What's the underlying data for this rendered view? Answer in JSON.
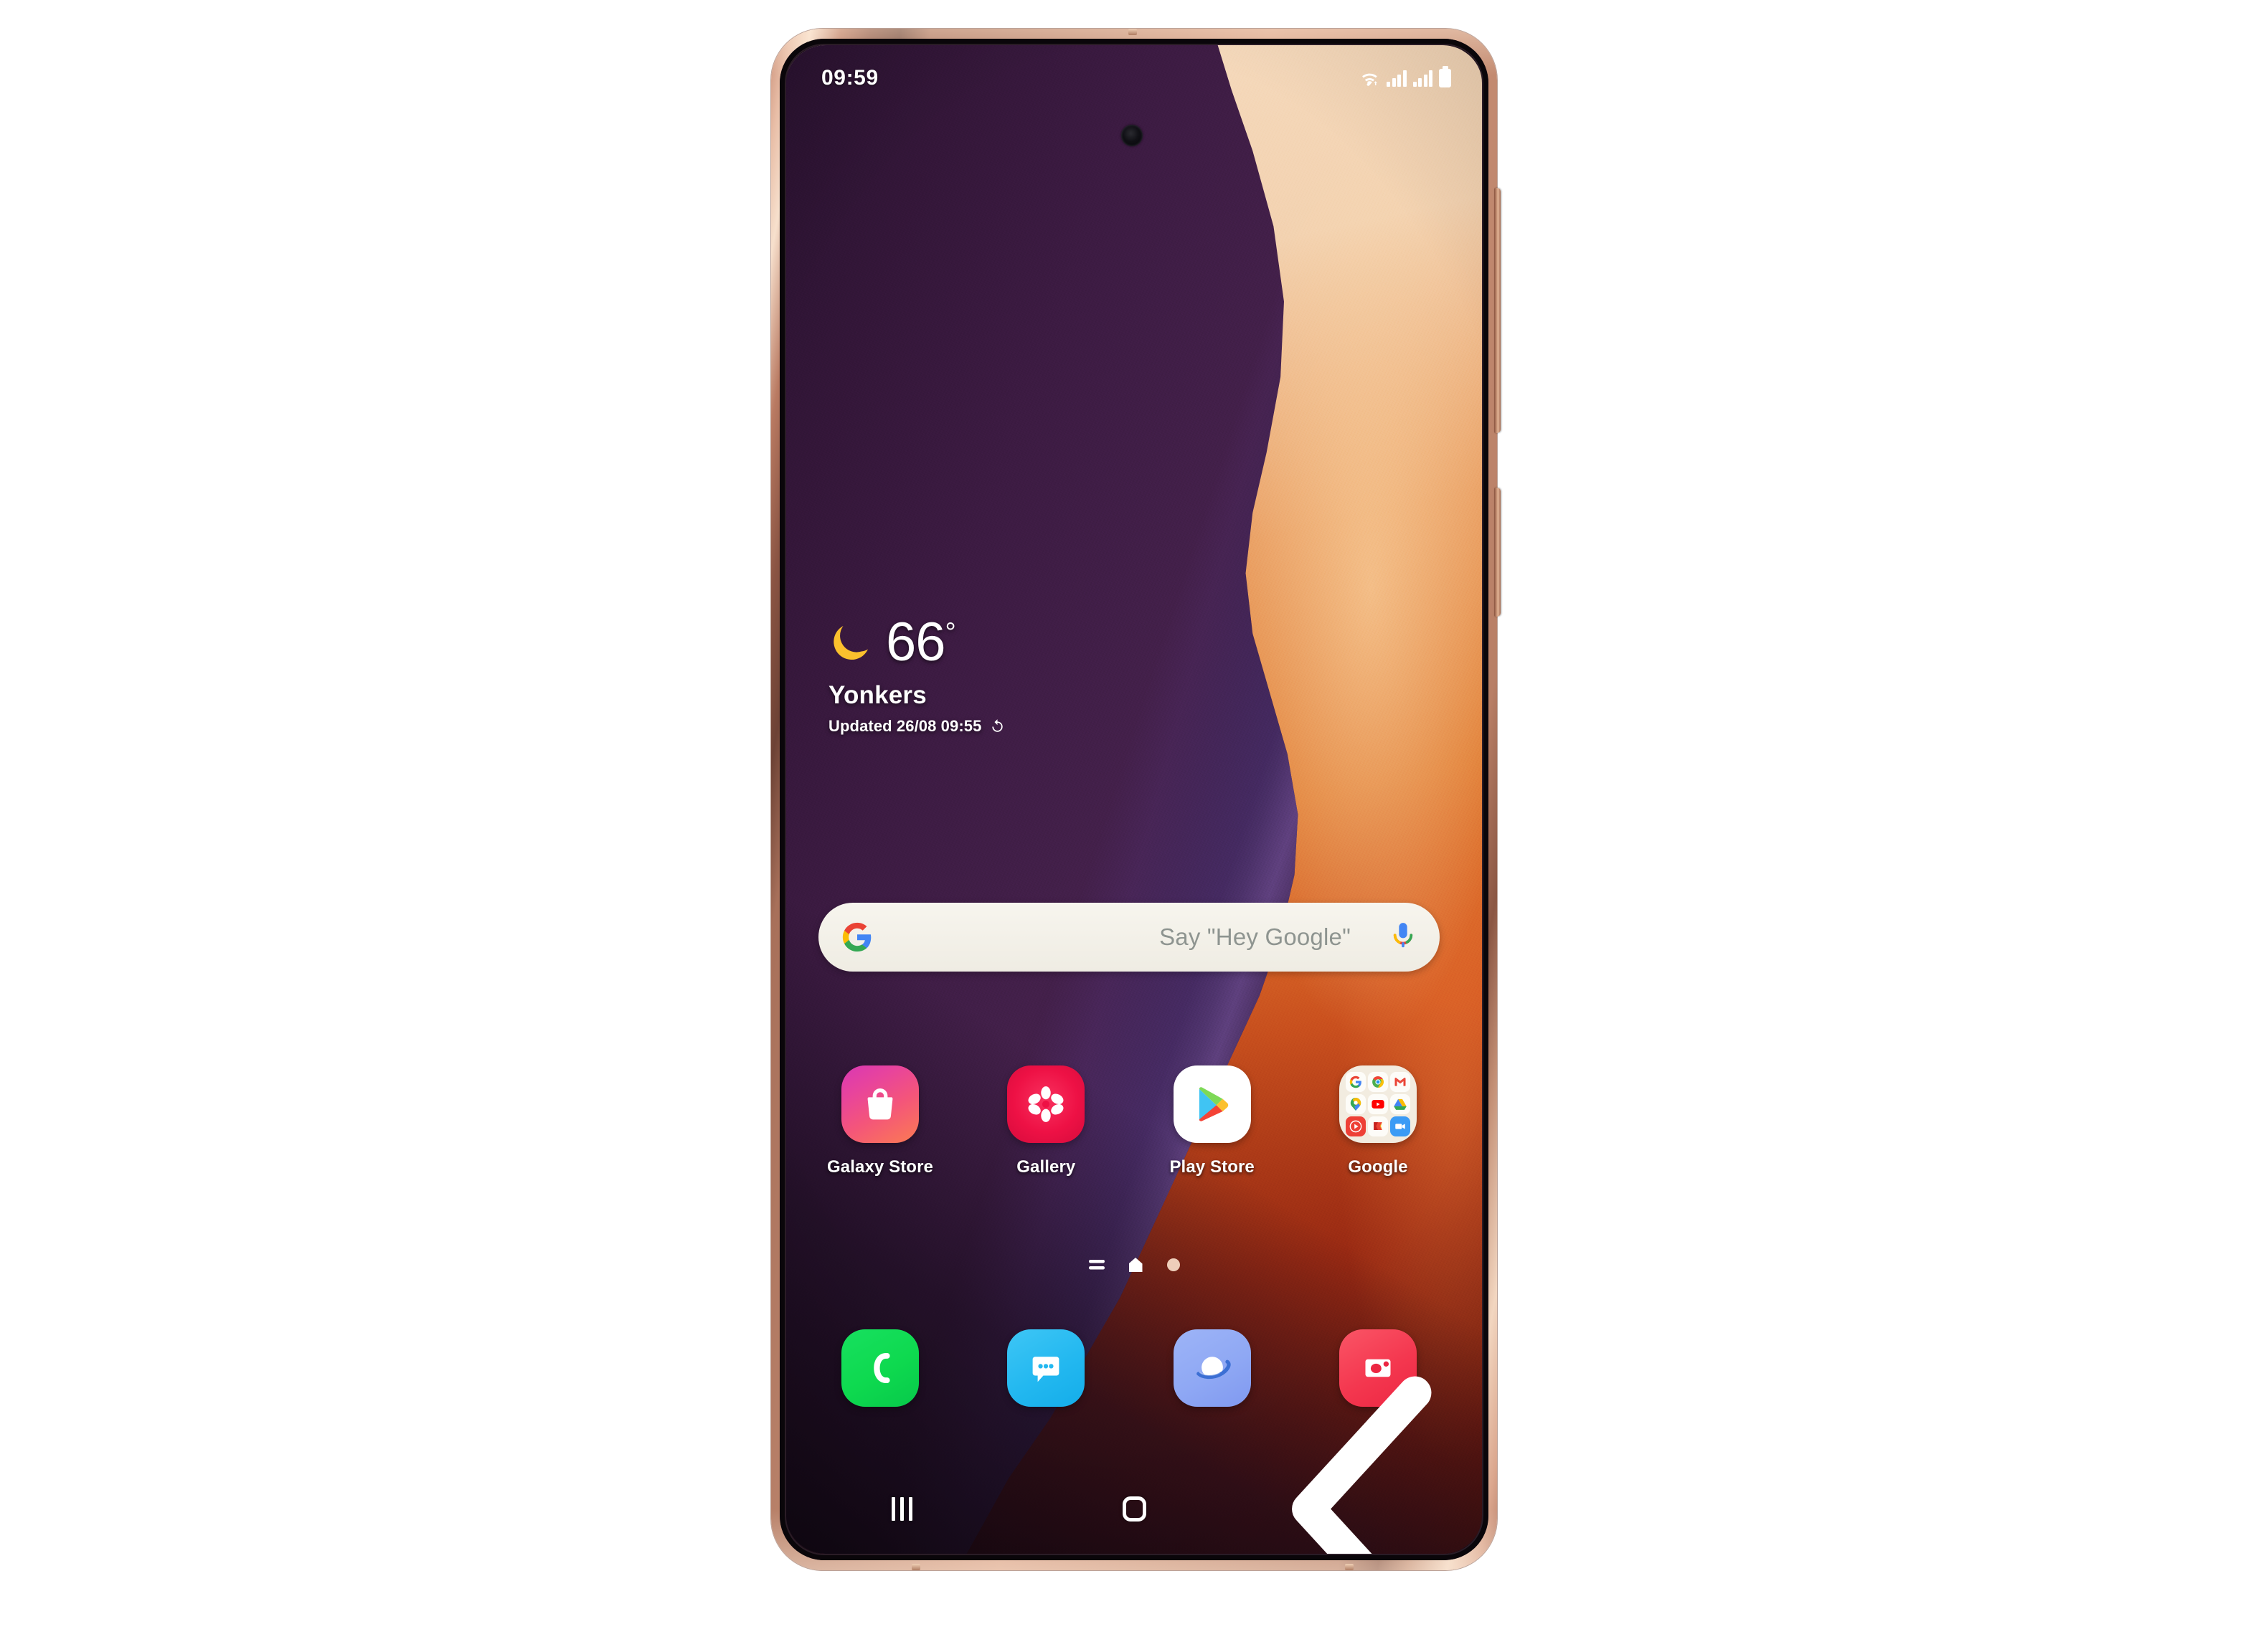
{
  "device": {
    "model_appearance": "samsung-galaxy-note20-ultra-mystic-bronze",
    "frame_color": "#c98f78"
  },
  "status_bar": {
    "time": "09:59",
    "icons": [
      "wifi-icon",
      "signal-bars-icon",
      "signal-bars-icon",
      "battery-icon"
    ]
  },
  "weather_widget": {
    "icon": "crescent-moon-icon",
    "icon_color": "#fbc02d",
    "temperature": "66",
    "degree_symbol": "°",
    "city": "Yonkers",
    "updated_text": "Updated 26/08 09:55",
    "refresh_icon": "refresh-icon"
  },
  "search_bar": {
    "logo": "google-g-icon",
    "placeholder": "Say \"Hey Google\"",
    "mic_icon": "google-mic-icon"
  },
  "app_grid": {
    "apps": [
      {
        "label": "Galaxy Store",
        "icon": "galaxy-store-icon",
        "color": "#e8449c"
      },
      {
        "label": "Gallery",
        "icon": "gallery-flower-icon",
        "color": "#ee1145"
      },
      {
        "label": "Play Store",
        "icon": "play-store-icon",
        "color": "#ffffff"
      },
      {
        "label": "Google",
        "icon": "google-folder-icon",
        "color": "#f2ece0"
      }
    ]
  },
  "google_folder": {
    "mini_apps": [
      "google-search-icon",
      "chrome-icon",
      "gmail-icon",
      "google-maps-icon",
      "youtube-icon",
      "google-drive-icon",
      "youtube-music-icon",
      "google-play-movies-icon",
      "google-meet-icon"
    ]
  },
  "page_indicator": {
    "dots": [
      "app-list-dot",
      "home-dot",
      "page-dot"
    ],
    "active_index": 1
  },
  "dock": {
    "apps": [
      {
        "name": "Phone",
        "icon": "phone-handset-icon",
        "color": "#0ed94f"
      },
      {
        "name": "Messages",
        "icon": "message-bubble-icon",
        "color": "#23b8f0"
      },
      {
        "name": "Samsung Internet",
        "icon": "internet-planet-icon",
        "color": "#8fa8f4"
      },
      {
        "name": "Camera",
        "icon": "camera-icon",
        "color": "#f4374f"
      }
    ]
  },
  "navigation_bar": {
    "buttons": [
      {
        "name": "Recents",
        "icon": "recents-icon"
      },
      {
        "name": "Home",
        "icon": "home-icon"
      },
      {
        "name": "Back",
        "icon": "back-chevron-icon"
      }
    ]
  }
}
